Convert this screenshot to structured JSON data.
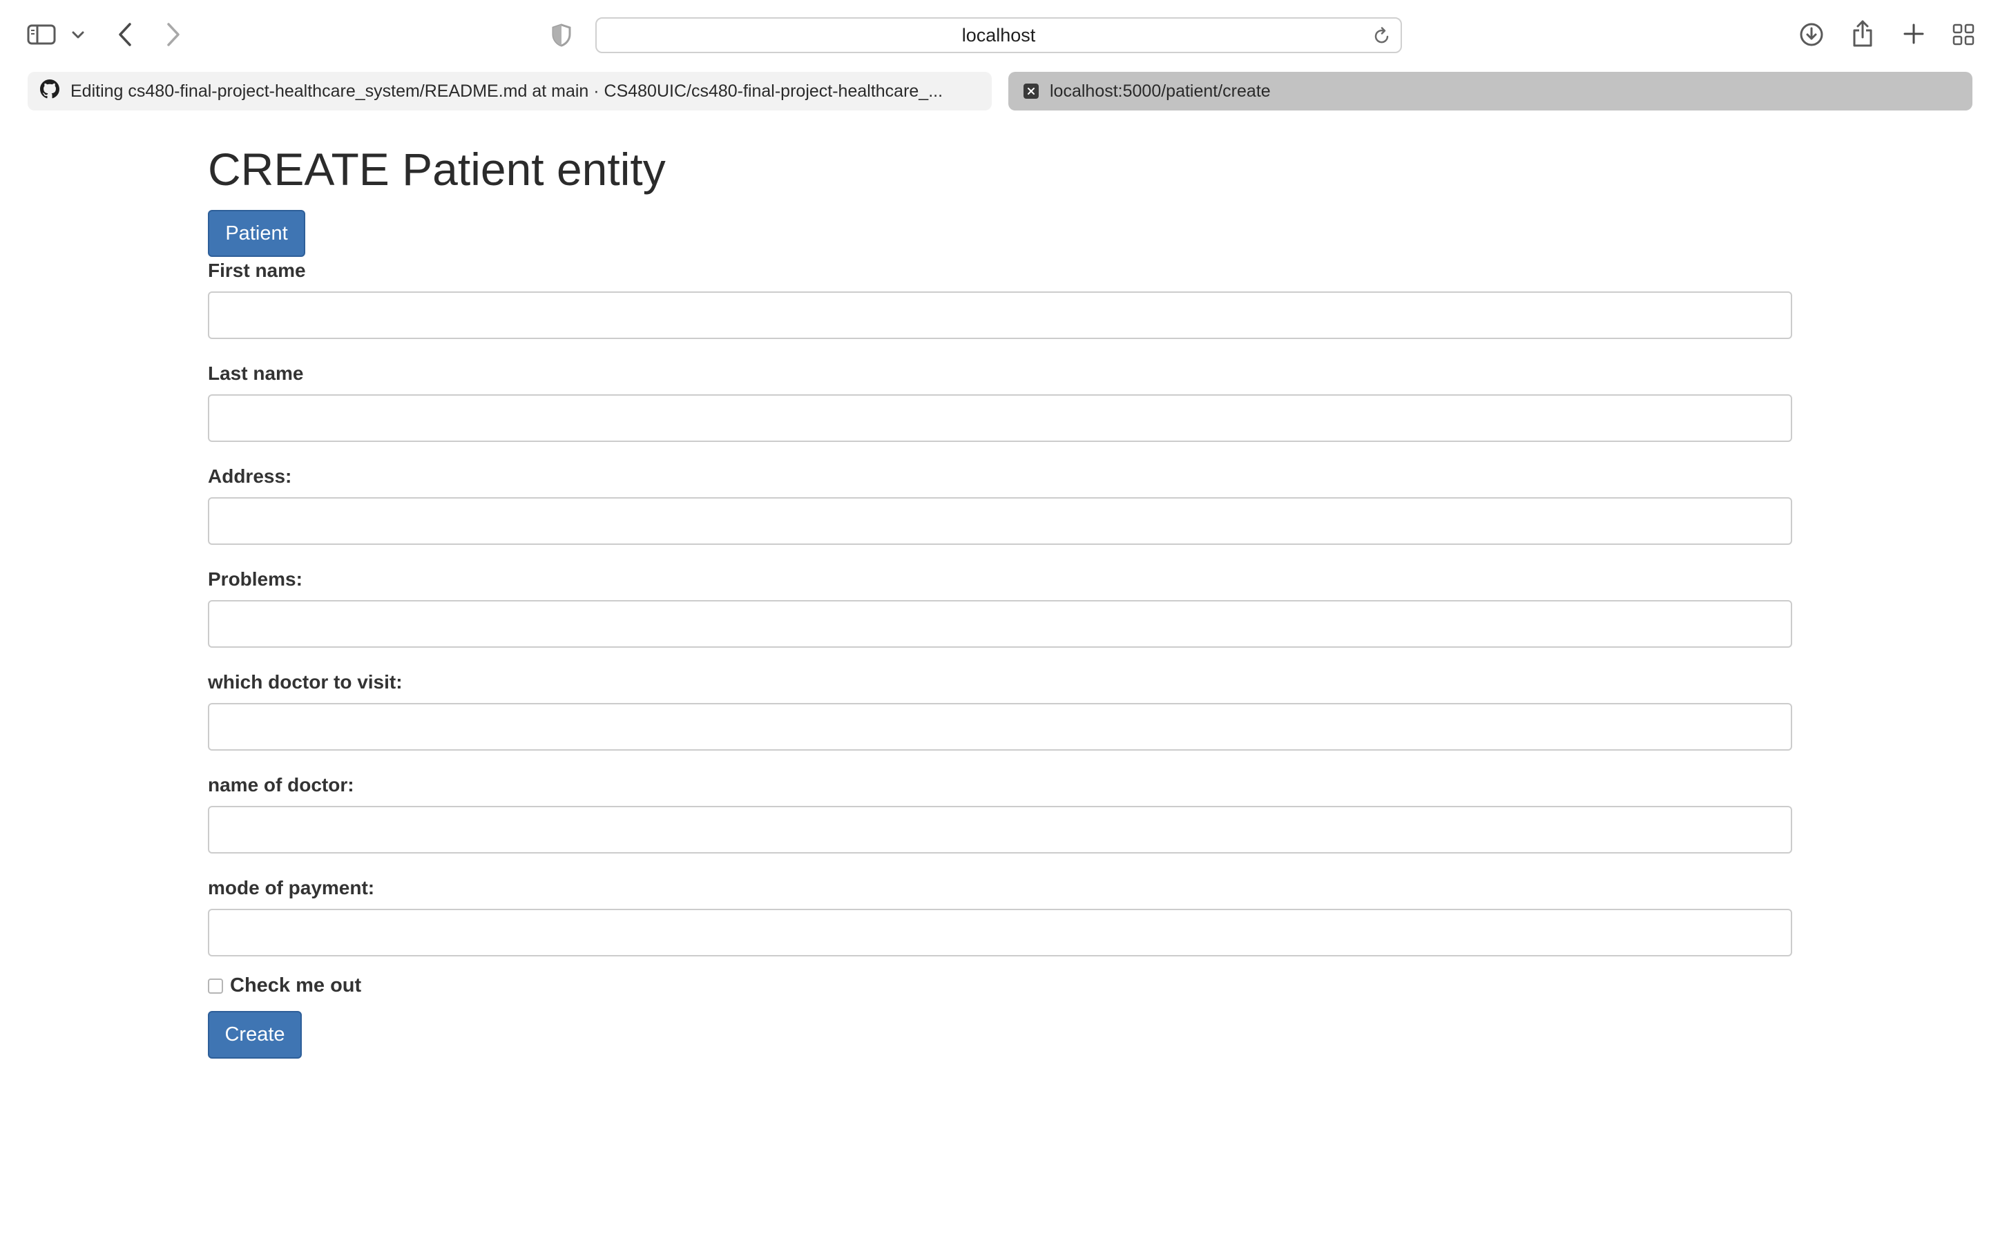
{
  "browser": {
    "address": "localhost",
    "tabs": [
      {
        "title": "Editing cs480-final-project-healthcare_system/README.md at main · CS480UIC/cs480-final-project-healthcare_...",
        "icon": "github-icon",
        "active": false
      },
      {
        "title": "localhost:5000/patient/create",
        "icon": "close-icon",
        "active": true
      }
    ],
    "icons": [
      "sidebar-icon",
      "chevron-down-icon",
      "back-icon",
      "forward-icon",
      "privacy-shield-icon",
      "reload-icon",
      "download-icon",
      "share-icon",
      "new-tab-icon",
      "tab-overview-icon"
    ]
  },
  "page": {
    "title": "CREATE Patient entity",
    "patient_button": "Patient",
    "fields": [
      {
        "label": "First name",
        "value": "",
        "placeholder": ""
      },
      {
        "label": "Last name",
        "value": "",
        "placeholder": ""
      },
      {
        "label": "Address:",
        "value": "",
        "placeholder": ""
      },
      {
        "label": "Problems:",
        "value": "",
        "placeholder": ""
      },
      {
        "label": "which doctor to visit:",
        "value": "",
        "placeholder": ""
      },
      {
        "label": "name of doctor:",
        "value": "",
        "placeholder": ""
      },
      {
        "label": "mode of payment:",
        "value": "",
        "placeholder": ""
      }
    ],
    "checkbox": {
      "label": "Check me out",
      "checked": false
    },
    "create_button": "Create"
  },
  "colors": {
    "button": "#3f75b3",
    "active_tab": "#c2c2c2",
    "inactive_tab": "#f2f2f2"
  }
}
